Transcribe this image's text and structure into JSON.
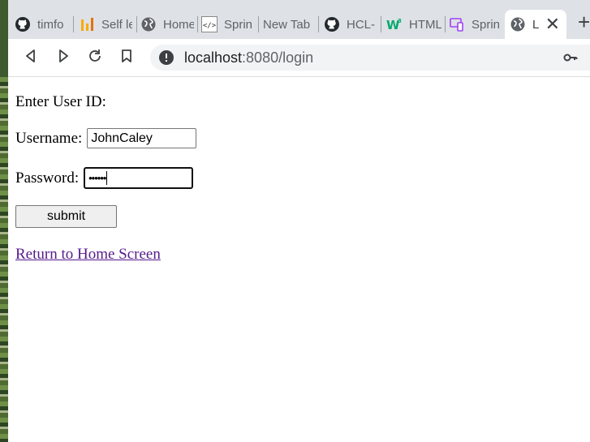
{
  "browser": {
    "tabs": [
      {
        "label": "timfo",
        "icon": "github-icon"
      },
      {
        "label": "Self le",
        "icon": "bar-chart-icon"
      },
      {
        "label": "Home",
        "icon": "globe-icon"
      },
      {
        "label": "Sprin",
        "icon": "code-tag-icon"
      },
      {
        "label": "New Tab",
        "icon": ""
      },
      {
        "label": "HCL-",
        "icon": "github-icon"
      },
      {
        "label": "HTML",
        "icon": "w3schools-icon"
      },
      {
        "label": "Sprin",
        "icon": "devices-icon"
      },
      {
        "label": "Lo",
        "icon": "globe-icon",
        "active": true
      }
    ],
    "close_glyph": "✕",
    "new_tab_glyph": "+",
    "address": {
      "host": "localhost",
      "path": ":8080/login"
    }
  },
  "form": {
    "heading": "Enter User ID:",
    "username_label": "Username:",
    "username_value": "JohnCaley",
    "password_label": "Password:",
    "password_value": "••••••",
    "submit_label": "submit"
  },
  "link": {
    "home": "Return to Home Screen"
  },
  "colors": {
    "link_visited": "#551a8b",
    "tabstrip": "#dee1e6",
    "w3_green": "#04aa6d",
    "chart_yellow": "#f9ab00"
  }
}
